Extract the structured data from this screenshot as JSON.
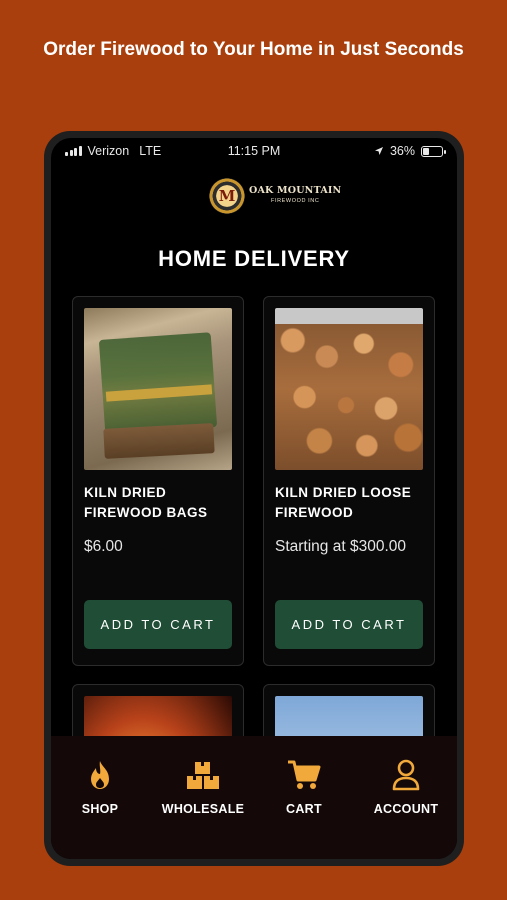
{
  "headline": "Order Firewood to Your Home in Just Seconds",
  "status_bar": {
    "carrier": "Verizon",
    "network": "LTE",
    "time": "11:15 PM",
    "battery": "36%",
    "battery_level": 0.36
  },
  "brand": {
    "emblem_letter": "M",
    "name": "OAK MOUNTAIN",
    "sub": "FIREWOOD INC"
  },
  "page_title": "HOME DELIVERY",
  "products": [
    {
      "name": "KILN DRIED FIREWOOD BAGS",
      "price": "$6.00",
      "button": "ADD TO CART"
    },
    {
      "name": "KILN DRIED LOOSE FIREWOOD",
      "price": "Starting at $300.00",
      "button": "ADD TO CART"
    }
  ],
  "tabs": [
    {
      "label": "SHOP",
      "icon": "flame-icon"
    },
    {
      "label": "WHOLESALE",
      "icon": "boxes-icon"
    },
    {
      "label": "CART",
      "icon": "cart-icon"
    },
    {
      "label": "ACCOUNT",
      "icon": "user-icon"
    }
  ],
  "colors": {
    "background": "#a83f0c",
    "button": "#1f4d35",
    "tab_icon": "#f0a93a",
    "tab_bar": "#140808"
  }
}
